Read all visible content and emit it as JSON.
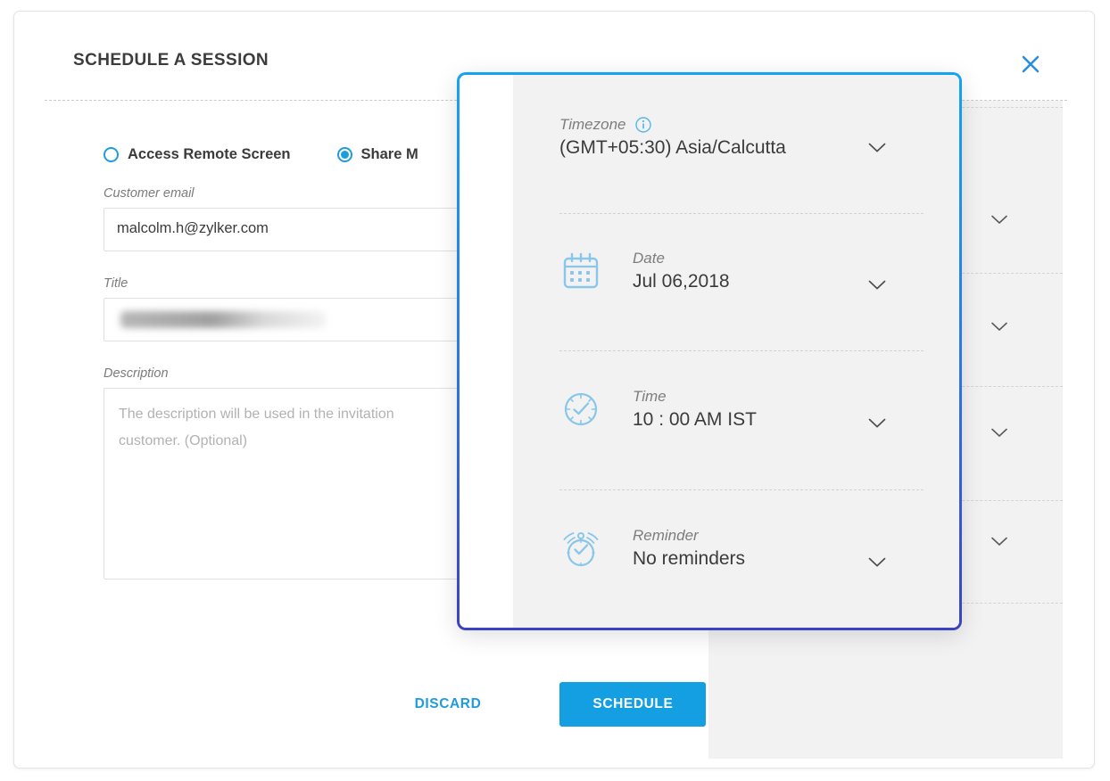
{
  "dialog": {
    "title": "SCHEDULE A SESSION",
    "close_icon": "close-icon"
  },
  "session_type": {
    "options": [
      {
        "label": "Access Remote Screen",
        "selected": false
      },
      {
        "label": "Share M",
        "selected": true
      }
    ]
  },
  "form": {
    "customer_email": {
      "label": "Customer email",
      "value": "malcolm.h@zylker.com",
      "placeholder": "Customer email"
    },
    "title": {
      "label": "Title",
      "value": "",
      "placeholder": "Title"
    },
    "description": {
      "label": "Description",
      "value": "",
      "placeholder": "The description will be used in the invitation\ncustomer. (Optional)",
      "placeholder_line1": "The description will be used in the invitation",
      "placeholder_line2": "customer. (Optional)"
    }
  },
  "footer": {
    "discard_label": "DISCARD",
    "schedule_label": "SCHEDULE"
  },
  "popup": {
    "rows": [
      {
        "label": "Timezone",
        "value": "(GMT+05:30) Asia/Calcutta",
        "icon": "none",
        "info_icon": "info-icon",
        "chevron": "chevron-down-icon"
      },
      {
        "label": "Date",
        "value": "Jul 06,2018",
        "icon": "calendar-icon",
        "chevron": "chevron-down-icon"
      },
      {
        "label": "Time",
        "value": "10 : 00 AM IST",
        "icon": "clock-icon",
        "chevron": "chevron-down-icon"
      },
      {
        "label": "Reminder",
        "value": "No reminders",
        "icon": "alarm-icon",
        "chevron": "chevron-down-icon"
      }
    ]
  },
  "colors": {
    "accent_blue": "#139fe2",
    "radio_blue": "#1f9bde",
    "popup_border_top": "#13a3f2",
    "popup_border_bottom": "#3a43c2",
    "icon_blue": "#8ac6ea",
    "text_dark": "#3b3b3b",
    "text_muted": "#7d7d7d",
    "panel_grey": "#f2f2f2"
  }
}
